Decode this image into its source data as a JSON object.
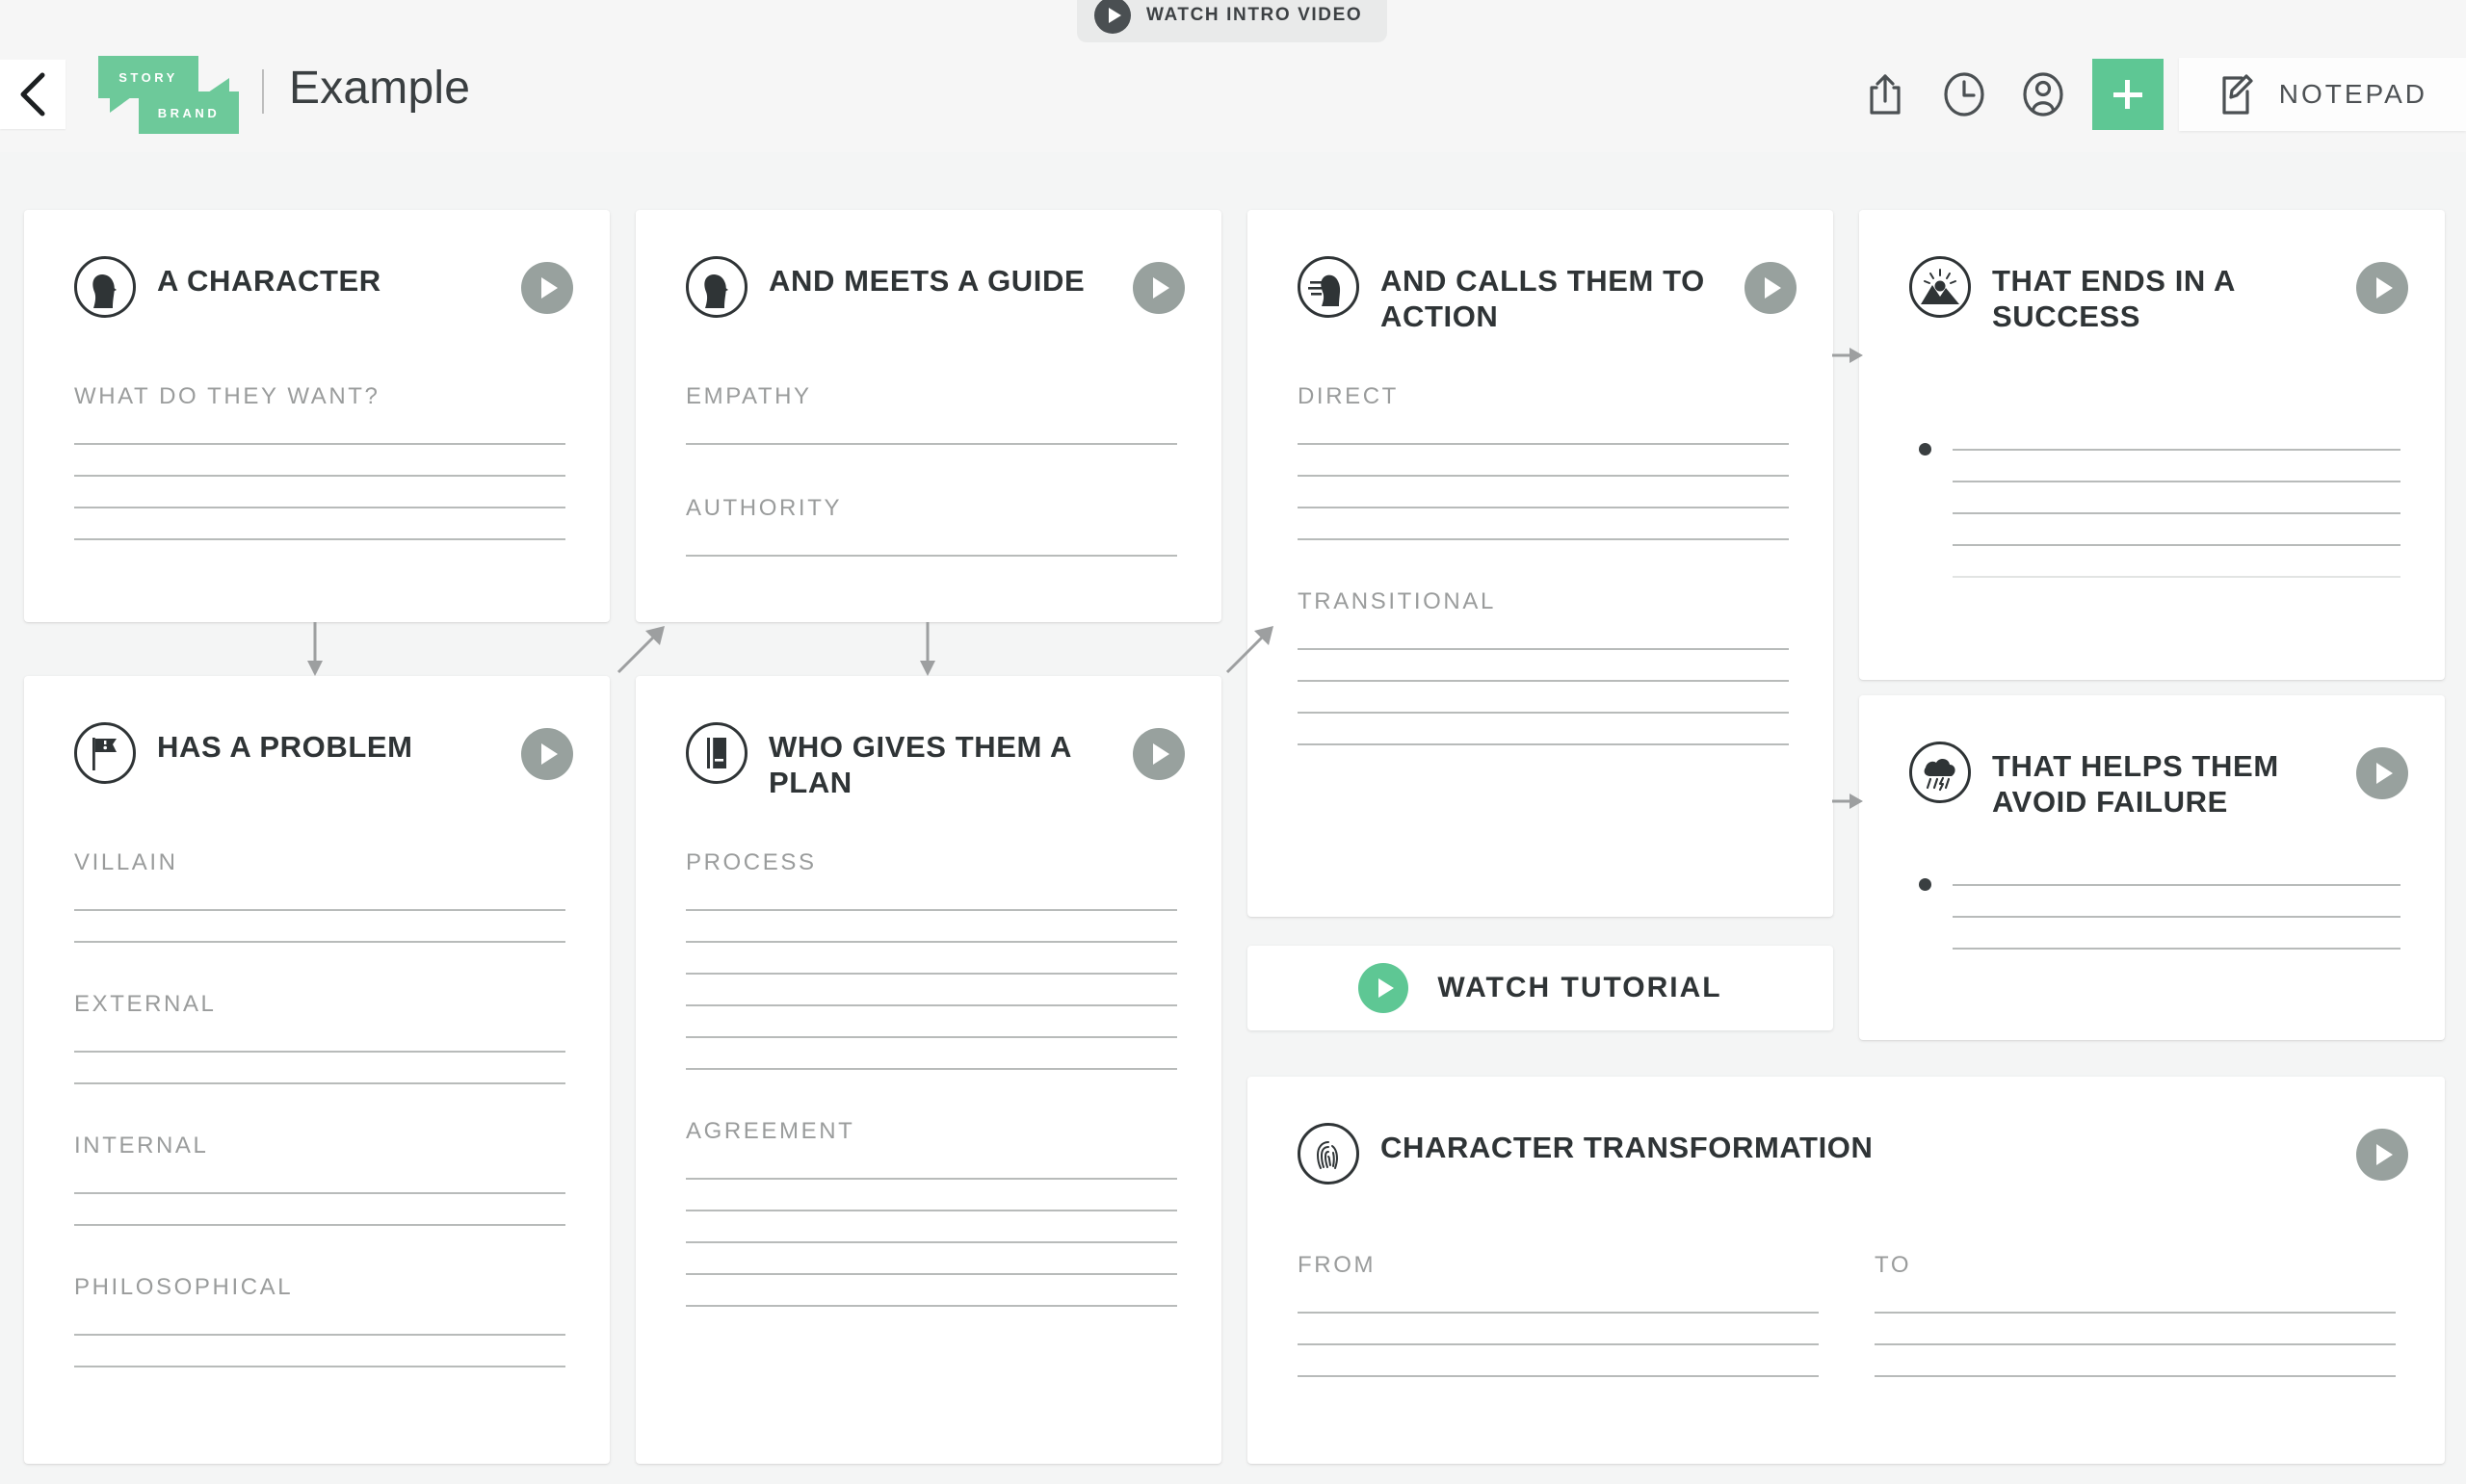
{
  "header": {
    "back_icon": "chevron-left-icon",
    "logo": {
      "line1": "STORY",
      "line2": "BRAND"
    },
    "divider": "|",
    "title": "Example",
    "intro_button": {
      "label": "WATCH INTRO VIDEO",
      "icon": "play-icon"
    },
    "tools": [
      {
        "name": "share-icon",
        "label": "Share"
      },
      {
        "name": "history-clock-icon",
        "label": "History"
      },
      {
        "name": "account-person-icon",
        "label": "Account"
      }
    ],
    "add_button": {
      "label": "+",
      "icon": "plus-icon",
      "color": "#5ec794"
    },
    "notepad_button": {
      "label": "NOTEPAD",
      "icon": "notepad-edit-icon"
    }
  },
  "accent_colors": {
    "brand_green": "#6dc99a",
    "button_green": "#5ec794",
    "play_gray": "#98a19e",
    "ink": "#2f3436",
    "label_gray": "#9a9c9c",
    "rule_gray": "#b8bbba",
    "page_bg": "#f4f5f5"
  },
  "cards": [
    {
      "id": "character",
      "icon": "profile-head-icon",
      "title": "A CHARACTER",
      "play": "play-icon",
      "sections": [
        {
          "label": "WHAT DO THEY WANT?",
          "lines": 4
        }
      ]
    },
    {
      "id": "guide",
      "icon": "profile-head-icon",
      "title": "AND MEETS A GUIDE",
      "play": "play-icon",
      "sections": [
        {
          "label": "EMPATHY",
          "lines": 1
        },
        {
          "label": "AUTHORITY",
          "lines": 1
        }
      ]
    },
    {
      "id": "call-to-action",
      "icon": "speaking-head-icon",
      "title": "AND CALLS THEM TO ACTION",
      "play": "play-icon",
      "sections": [
        {
          "label": "DIRECT",
          "lines": 4
        },
        {
          "label": "TRANSITIONAL",
          "lines": 4
        }
      ]
    },
    {
      "id": "success",
      "icon": "mountain-sunrise-icon",
      "title": "THAT ENDS IN A SUCCESS",
      "play": "play-icon",
      "bulleted": true,
      "sections": [
        {
          "label": "",
          "lines": 5
        }
      ]
    },
    {
      "id": "problem",
      "icon": "villain-flag-icon",
      "title": "HAS A PROBLEM",
      "play": "play-icon",
      "sections": [
        {
          "label": "VILLAIN",
          "lines": 2
        },
        {
          "label": "EXTERNAL",
          "lines": 2
        },
        {
          "label": "INTERNAL",
          "lines": 2
        },
        {
          "label": "PHILOSOPHICAL",
          "lines": 2
        }
      ]
    },
    {
      "id": "plan",
      "icon": "book-icon",
      "title": "WHO GIVES THEM A PLAN",
      "play": "play-icon",
      "sections": [
        {
          "label": "PROCESS",
          "lines": 6
        },
        {
          "label": "AGREEMENT",
          "lines": 5
        }
      ]
    },
    {
      "id": "failure",
      "icon": "storm-cloud-icon",
      "title": "THAT HELPS THEM AVOID FAILURE",
      "play": "play-icon",
      "bulleted": true,
      "sections": [
        {
          "label": "",
          "lines": 3
        }
      ]
    },
    {
      "id": "transformation",
      "icon": "fingerprint-icon",
      "title": "CHARACTER TRANSFORMATION",
      "play": "play-icon",
      "sections": [
        {
          "label": "FROM",
          "lines": 3
        },
        {
          "label": "TO",
          "lines": 3
        }
      ]
    }
  ],
  "tutorial_button": {
    "label": "WATCH TUTORIAL",
    "icon": "play-icon"
  },
  "connectors": [
    {
      "name": "arrow-character-to-problem",
      "direction": "down"
    },
    {
      "name": "arrow-problem-to-guide",
      "direction": "up-right"
    },
    {
      "name": "arrow-guide-to-plan",
      "direction": "down"
    },
    {
      "name": "arrow-plan-to-cta",
      "direction": "up-right"
    },
    {
      "name": "arrow-cta-to-success",
      "direction": "right"
    },
    {
      "name": "arrow-cta-to-failure",
      "direction": "right"
    }
  ]
}
